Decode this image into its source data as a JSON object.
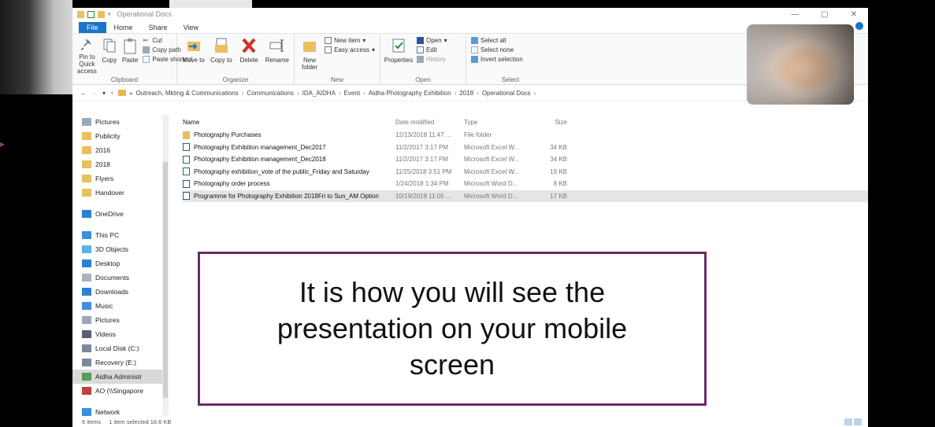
{
  "window": {
    "title": "Operational Docs"
  },
  "tabs": [
    "File",
    "Home",
    "Share",
    "View"
  ],
  "ribbon": {
    "clipboard": {
      "pin": "Pin to Quick access",
      "copy": "Copy",
      "paste": "Paste",
      "cut": "Cut",
      "copy_path": "Copy path",
      "paste_shortcut": "Paste shortcut",
      "label": "Clipboard"
    },
    "organize": {
      "move": "Move to",
      "copy": "Copy to",
      "delete": "Delete",
      "rename": "Rename",
      "label": "Organize"
    },
    "new": {
      "new_folder": "New folder",
      "new_item": "New item",
      "easy_access": "Easy access",
      "label": "New"
    },
    "open": {
      "properties": "Properties",
      "open": "Open",
      "edit": "Edit",
      "history": "History",
      "label": "Open"
    },
    "select": {
      "select_all": "Select all",
      "select_none": "Select none",
      "invert": "Invert selection",
      "label": "Select"
    }
  },
  "breadcrumb": [
    "«",
    "Outreach, Mkting & Communications",
    "Communications",
    "IDA_AIDHA",
    "Event",
    "Aidha Photography Exhibition",
    "2018",
    "Operational Docs"
  ],
  "nav": [
    {
      "label": "Pictures",
      "icon": "pictures-icon",
      "color": "#9aa8b8"
    },
    {
      "label": "Publicity",
      "icon": "folder-icon",
      "color": "#e8c060"
    },
    {
      "label": "2016",
      "icon": "folder-icon",
      "color": "#e8c060"
    },
    {
      "label": "2018",
      "icon": "folder-icon",
      "color": "#e8c060"
    },
    {
      "label": "Flyers",
      "icon": "folder-icon",
      "color": "#e8c060"
    },
    {
      "label": "Handover",
      "icon": "folder-icon",
      "color": "#e8c060"
    },
    {
      "label": "",
      "icon": "spacer",
      "color": "transparent"
    },
    {
      "label": "OneDrive",
      "icon": "cloud-icon",
      "color": "#2d7fd3"
    },
    {
      "label": "",
      "icon": "spacer",
      "color": "transparent"
    },
    {
      "label": "This PC",
      "icon": "monitor-icon",
      "color": "#3b8fdc"
    },
    {
      "label": "3D Objects",
      "icon": "cube-icon",
      "color": "#5ab0e8"
    },
    {
      "label": "Desktop",
      "icon": "desktop-icon",
      "color": "#2d7fd3"
    },
    {
      "label": "Documents",
      "icon": "document-icon",
      "color": "#a8b4c0"
    },
    {
      "label": "Downloads",
      "icon": "download-icon",
      "color": "#2d7fd3"
    },
    {
      "label": "Music",
      "icon": "music-icon",
      "color": "#3b8fdc"
    },
    {
      "label": "Pictures",
      "icon": "pictures-icon",
      "color": "#9aa8b8"
    },
    {
      "label": "Videos",
      "icon": "video-icon",
      "color": "#556070"
    },
    {
      "label": "Local Disk (C:)",
      "icon": "disk-icon",
      "color": "#7a8a9a"
    },
    {
      "label": "Recovery (E:)",
      "icon": "disk-icon",
      "color": "#7a8a9a"
    },
    {
      "label": "Aidha Administr",
      "icon": "network-drive-icon",
      "color": "#5a9a5a"
    },
    {
      "label": "AO (\\\\Singapore",
      "icon": "network-drive-icon",
      "color": "#c04040"
    },
    {
      "label": "",
      "icon": "spacer",
      "color": "transparent"
    },
    {
      "label": "Network",
      "icon": "network-icon",
      "color": "#3b8fdc"
    }
  ],
  "nav_selected_index": 19,
  "columns": {
    "name": "Name",
    "date": "Date modified",
    "type": "Type",
    "size": "Size"
  },
  "files": [
    {
      "name": "Photography Purchases",
      "date": "12/13/2018 11:47 ...",
      "type": "File folder",
      "size": "",
      "kind": "folder"
    },
    {
      "name": "Photography Exhibition management_Dec2017",
      "date": "11/2/2017 3:17 PM",
      "type": "Microsoft Excel W...",
      "size": "34 KB",
      "kind": "xls"
    },
    {
      "name": "Photography Exhibition management_Dec2018",
      "date": "11/2/2017 3:17 PM",
      "type": "Microsoft Excel W...",
      "size": "34 KB",
      "kind": "xls"
    },
    {
      "name": "Photography exhibition_vote of the public_Friday and Saturday",
      "date": "11/25/2018 3:51 PM",
      "type": "Microsoft Excel W...",
      "size": "19 KB",
      "kind": "xls"
    },
    {
      "name": "Photography order process",
      "date": "1/24/2018 1:34 PM",
      "type": "Microsoft Word D...",
      "size": "8 KB",
      "kind": "doc"
    },
    {
      "name": "Programme for Photography Exhibition 2018Fri to Sun_AM Option",
      "date": "10/19/2018 11:05 ...",
      "type": "Microsoft Word D...",
      "size": "17 KB",
      "kind": "doc",
      "selected": true
    }
  ],
  "status": {
    "count": "6 items",
    "selection": "1 item selected  16.6 KB"
  },
  "caption": "It is how you will see the presentation on your mobile screen",
  "colors": {
    "accent": "#1a73c8",
    "caption_border": "#6e2a6a"
  }
}
